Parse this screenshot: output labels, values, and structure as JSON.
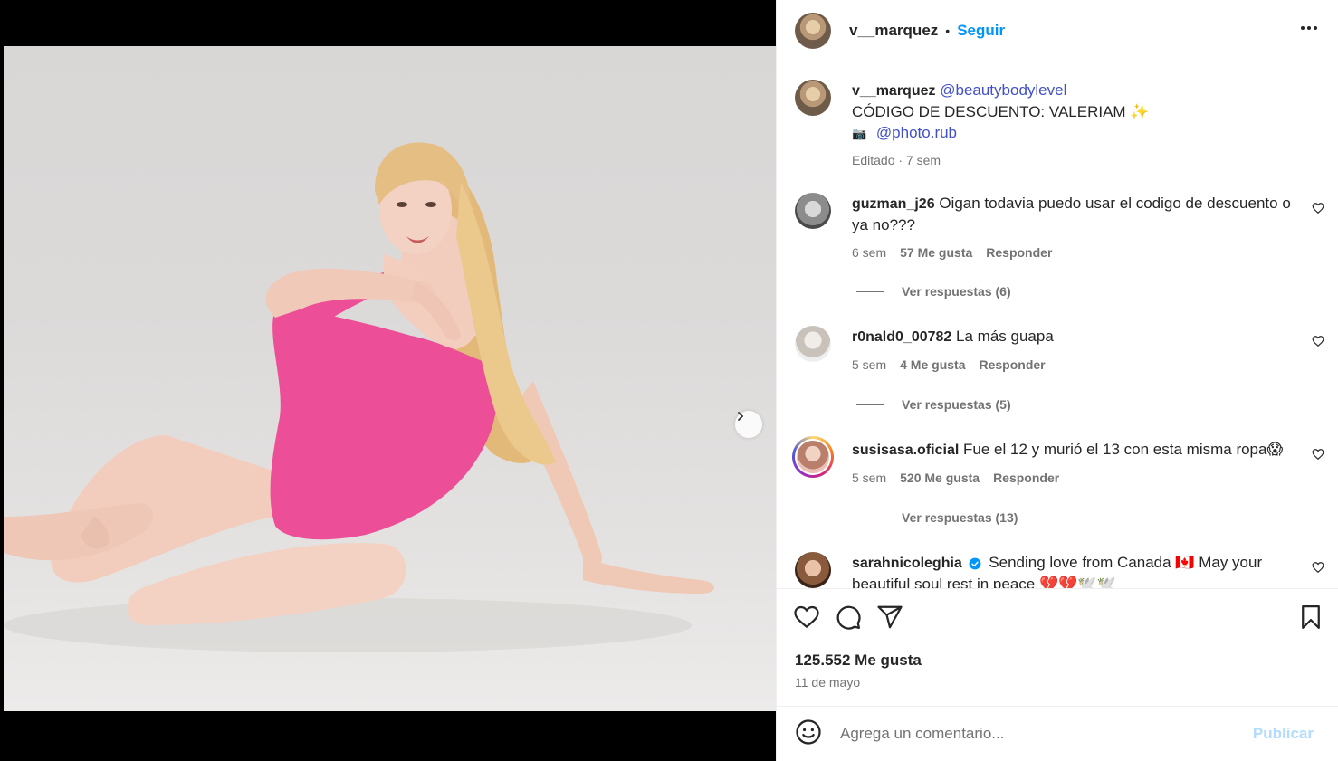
{
  "post": {
    "username": "v__marquez",
    "separator": "•",
    "follow_label": "Seguir",
    "more_icon": "more-horizontal-icon",
    "media": {
      "slide_count": 3,
      "active_slide": 1,
      "next_icon": "chevron-right-icon"
    }
  },
  "caption": {
    "username": "v__marquez",
    "mention1": "@beautybodylevel",
    "line2": "CÓDIGO DE DESCUENTO: VALERIAM",
    "line2_emoji": "✨",
    "camera_emoji": "📷",
    "mention2": "@photo.rub",
    "edited": "Editado",
    "dot": "·",
    "time": "7 sem"
  },
  "comments": [
    {
      "username": "guzman_j26",
      "text": "Oigan todavia puedo usar el codigo de descuento o ya no???",
      "time": "6 sem",
      "likes": "57 Me gusta",
      "reply": "Responder",
      "view_replies": "Ver respuestas (6)"
    },
    {
      "username": "r0nald0_00782",
      "text": "La más guapa",
      "time": "5 sem",
      "likes": "4 Me gusta",
      "reply": "Responder",
      "view_replies": "Ver respuestas (5)"
    },
    {
      "username": "susisasa.oficial",
      "text": "Fue el 12 y murió el 13 con esta misma ropa😱",
      "time": "5 sem",
      "likes": "520 Me gusta",
      "reply": "Responder",
      "view_replies": "Ver respuestas (13)"
    },
    {
      "username": "sarahnicoleghia",
      "verified": true,
      "text": "Sending love from Canada 🇨🇦 May your beautiful soul rest in peace 💔💔🕊️🕊️"
    }
  ],
  "actions": {
    "like_icon": "heart-icon",
    "comment_icon": "comment-icon",
    "share_icon": "send-icon",
    "save_icon": "bookmark-icon",
    "likes": "125.552 Me gusta",
    "date": "11 de mayo"
  },
  "add_comment": {
    "emoji_icon": "emoji-icon",
    "placeholder": "Agrega un comentario...",
    "publish_label": "Publicar"
  },
  "colors": {
    "follow": "#0095f6",
    "mention": "#4150c8",
    "publish_disabled": "#b3dbff",
    "swimsuit": "#ec4f97"
  }
}
